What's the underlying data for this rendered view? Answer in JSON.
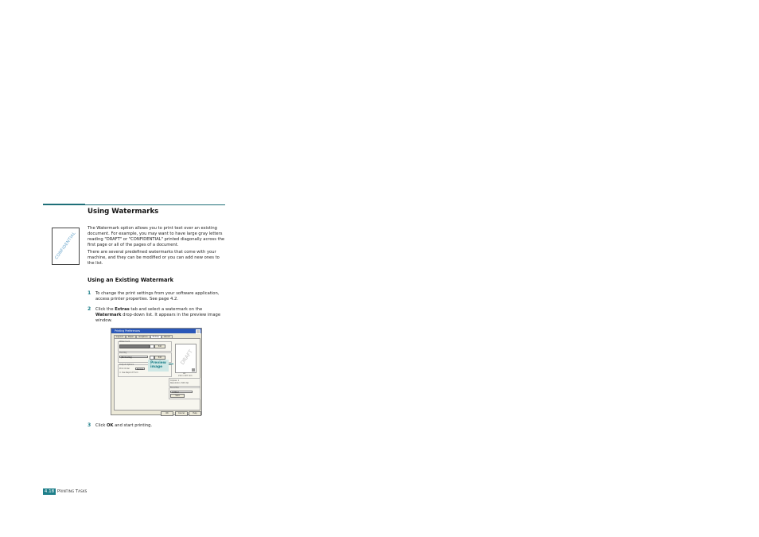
{
  "section": {
    "title": "Using Watermarks",
    "icon_text": "CONFIDENTIAL",
    "intro_paragraphs": [
      "The Watermark option allows you to print text over an existing document. For example, you may want to have large gray letters reading \"DRAFT\" or \"CONFIDENTIAL\" printed diagonally across the first page or all of the pages of a document.",
      "There are several predefined watermarks that come with your machine, and they can be modified or you can add new ones to the list."
    ]
  },
  "subsection": {
    "title": "Using an Existing Watermark",
    "steps": [
      {
        "num": "1",
        "text": "To change the print settings from your software application, access printer properties. See page 4.2."
      },
      {
        "num": "2",
        "pre": "Click the ",
        "b1": "Extras",
        "mid": " tab and select a watermark on the ",
        "b2": "Watermark",
        "post": " drop-down list. It appears in the preview image window."
      },
      {
        "num": "3",
        "pre": "Click ",
        "b1": "OK",
        "post": " and start printing."
      }
    ]
  },
  "dialog": {
    "title": "Printing Preferences",
    "tabs": [
      "Layout",
      "Paper",
      "Graphics",
      "Extras",
      "About"
    ],
    "active_tab": "Extras",
    "watermark_group": "Watermark",
    "overlay_group": "Overlay",
    "overlay_value": "(No Overlay)",
    "output_group": "Output Options",
    "print_order_label": "Print Order",
    "print_order_value": "Normal",
    "reprint_label": "Use Reprint Form",
    "edit_label": "Edit",
    "preview_text": "DRAFT",
    "size_label": "A4",
    "size_mm": "210 x 297 mm",
    "copies_label": "Copies: 1",
    "resolution_label": "Resolution: 600 dpi",
    "favorites_group": "Favorites",
    "favorites_value": "Untitled",
    "save_label": "Save",
    "ok_label": "OK",
    "cancel_label": "Cancel",
    "help_label": "Help"
  },
  "callout": {
    "line1": "Preview",
    "line2": "image"
  },
  "footer": {
    "page": "4.18",
    "title_p": "P",
    "title_rest1": "RINTING ",
    "title_t": "T",
    "title_rest2": "ASKS"
  }
}
